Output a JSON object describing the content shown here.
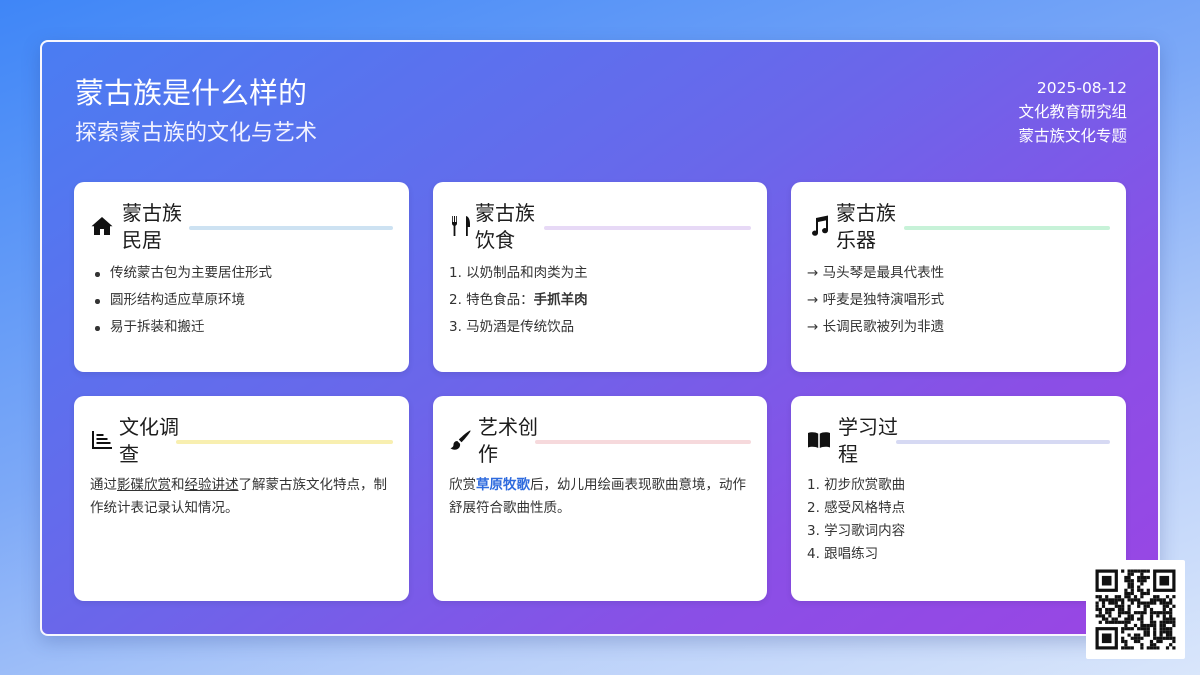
{
  "header": {
    "title": "蒙古族是什么样的",
    "subtitle": "探索蒙古族的文化与艺术",
    "date": "2025-08-12",
    "org": "文化教育研究组",
    "topic": "蒙古族文化专题"
  },
  "cards": [
    {
      "icon": "house-icon",
      "title": "蒙古族民居",
      "line_color": "#cde2f2",
      "items": [
        "传统蒙古包为主要居住形式",
        "圆形结构适应草原环境",
        "易于拆装和搬迁"
      ]
    },
    {
      "icon": "utensils-icon",
      "title": "蒙古族饮食",
      "line_color": "#e7d9f6",
      "items": [
        "1. 以奶制品和肉类为主",
        "3. 马奶酒是传统饮品"
      ],
      "item2_prefix": "2. 特色食品：",
      "item2_bold": "手抓羊肉"
    },
    {
      "icon": "music-note-icon",
      "title": "蒙古族乐器",
      "line_color": "#c7f2d8",
      "items": [
        "→ 马头琴是最具代表性",
        "→ 呼麦是独特演唱形式",
        "→ 长调民歌被列为非遗"
      ]
    },
    {
      "icon": "chart-icon",
      "title": "文化调查",
      "line_color": "#f8efb0",
      "text": {
        "p1": "通过",
        "u1": "影碟欣赏",
        "p2": "和",
        "u2": "经验讲述",
        "p3": "了解蒙古族文化特点，制作统计表记录认知情况。"
      }
    },
    {
      "icon": "paintbrush-icon",
      "title": "艺术创作",
      "line_color": "#f6d9dc",
      "text": {
        "p1": "欣赏",
        "hl": "草原牧歌",
        "p2": "后，幼儿用绘画表现歌曲意境，动作舒展符合歌曲性质。"
      }
    },
    {
      "icon": "book-icon",
      "title": "学习过程",
      "line_color": "#d6d9f3",
      "items": [
        "1. 初步欣赏歌曲",
        "2. 感受风格特点",
        "3. 学习歌词内容",
        "4. 跟唱练习"
      ]
    }
  ],
  "qr_icon": "qr-code-icon"
}
